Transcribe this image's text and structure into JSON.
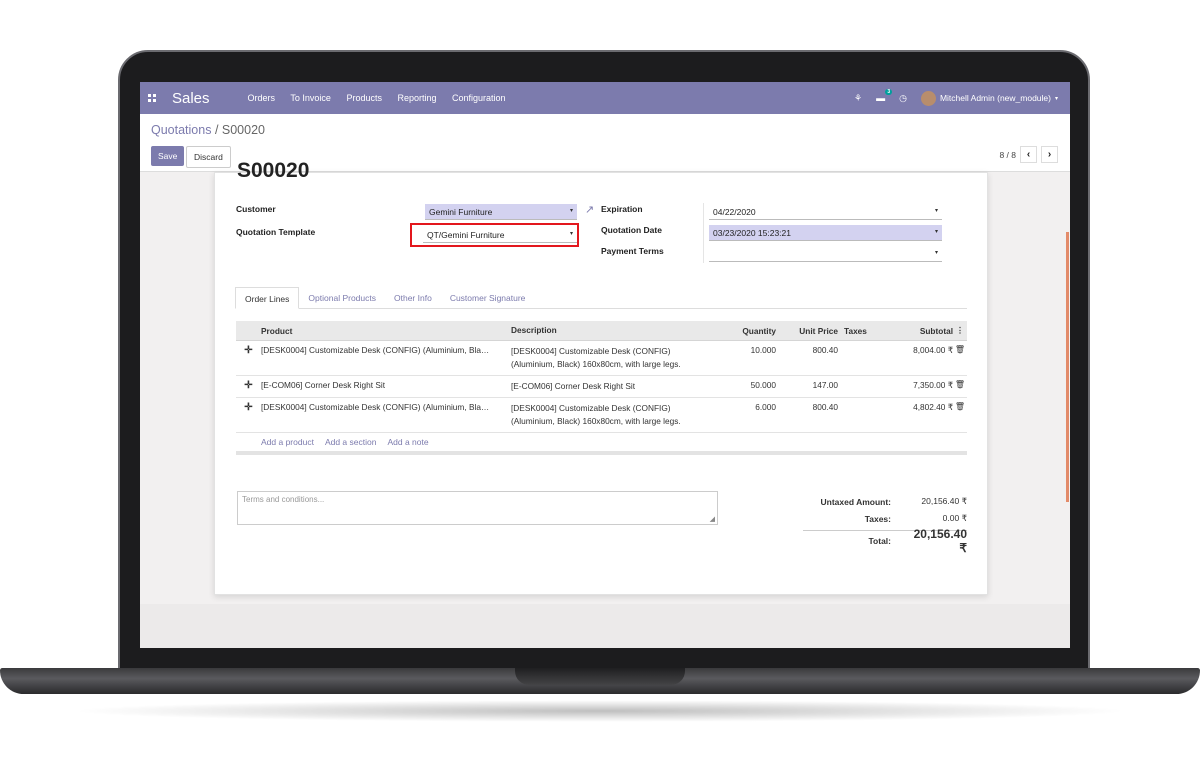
{
  "navbar": {
    "app": "Sales",
    "menu": [
      "Orders",
      "To Invoice",
      "Products",
      "Reporting",
      "Configuration"
    ],
    "chat_count": "3",
    "user": "Mitchell Admin (new_module)"
  },
  "breadcrumb": {
    "parent": "Quotations",
    "separator": " / ",
    "current": "S00020"
  },
  "buttons": {
    "save": "Save",
    "discard": "Discard"
  },
  "pager": {
    "text": "8 / 8",
    "prev": "‹",
    "next": "›"
  },
  "record": {
    "title": "S00020",
    "customer_label": "Customer",
    "customer": "Gemini Furniture",
    "template_label": "Quotation Template",
    "template": "QT/Gemini Furniture",
    "expiration_label": "Expiration",
    "expiration": "04/22/2020",
    "qdate_label": "Quotation Date",
    "qdate": "03/23/2020 15:23:21",
    "payterms_label": "Payment Terms",
    "payterms": ""
  },
  "tabs": [
    "Order Lines",
    "Optional Products",
    "Other Info",
    "Customer Signature"
  ],
  "table": {
    "headers": {
      "product": "Product",
      "description": "Description",
      "quantity": "Quantity",
      "price": "Unit Price",
      "taxes": "Taxes",
      "subtotal": "Subtotal"
    },
    "rows": [
      {
        "product": "[DESK0004] Customizable Desk (CONFIG) (Aluminium, Bla…",
        "description": "[DESK0004] Customizable Desk (CONFIG) (Aluminium, Black) 160x80cm, with large legs.",
        "quantity": "10.000",
        "price": "800.40",
        "taxes": "",
        "subtotal": "8,004.00 ₹"
      },
      {
        "product": "[E-COM06] Corner Desk Right Sit",
        "description": "[E-COM06] Corner Desk Right Sit",
        "quantity": "50.000",
        "price": "147.00",
        "taxes": "",
        "subtotal": "7,350.00 ₹"
      },
      {
        "product": "[DESK0004] Customizable Desk (CONFIG) (Aluminium, Bla…",
        "description": "[DESK0004] Customizable Desk (CONFIG) (Aluminium, Black) 160x80cm, with large legs.",
        "quantity": "6.000",
        "price": "800.40",
        "taxes": "",
        "subtotal": "4,802.40 ₹"
      }
    ],
    "add_product": "Add a product",
    "add_section": "Add a section",
    "add_note": "Add a note"
  },
  "terms_placeholder": "Terms and conditions...",
  "totals": {
    "untaxed_label": "Untaxed Amount:",
    "untaxed": "20,156.40 ₹",
    "taxes_label": "Taxes:",
    "taxes": "0.00 ₹",
    "total_label": "Total:",
    "total": "20,156.40 ₹"
  },
  "colors": {
    "brand": "#7c7bad",
    "required_field": "#d3d2f0",
    "highlight": "#e3171d"
  }
}
